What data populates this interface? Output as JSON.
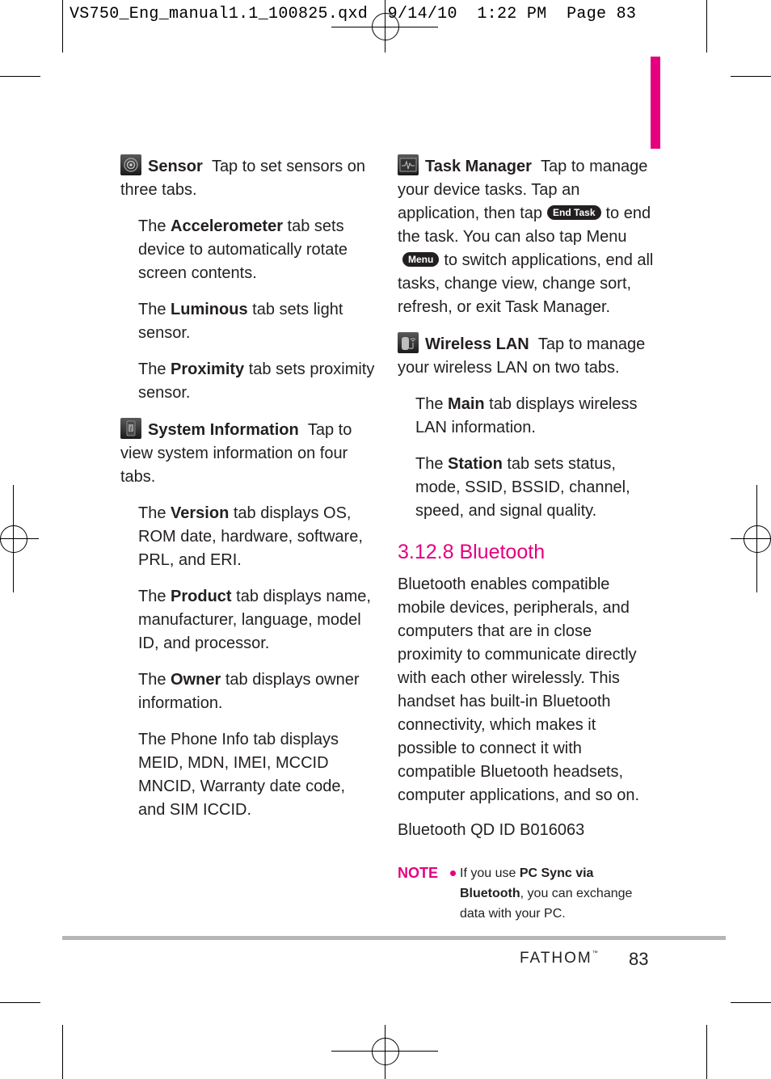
{
  "slug": "VS750_Eng_manual1.1_100825.qxd  9/14/10  1:22 PM  Page 83",
  "colors": {
    "accent": "#e5007e",
    "text": "#231f20",
    "rule": "#b5b5b5"
  },
  "left_column": {
    "sensor": {
      "icon": "sensor-icon",
      "term": "Sensor",
      "desc": "Tap to set sensors on three tabs.",
      "tabs": [
        {
          "pre": "The ",
          "term": "Accelerometer",
          "post": " tab sets device to automatically rotate screen contents."
        },
        {
          "pre": "The ",
          "term": "Luminous",
          "post": " tab sets light sensor."
        },
        {
          "pre": "The ",
          "term": "Proximity",
          "post": " tab sets proximity sensor."
        }
      ]
    },
    "system_info": {
      "icon": "info-icon",
      "term": "System Information",
      "desc": "Tap to view system information on four tabs.",
      "tabs": [
        {
          "pre": "The ",
          "term": "Version",
          "post": " tab displays OS, ROM date, hardware, software, PRL, and ERI."
        },
        {
          "pre": "The ",
          "term": "Product",
          "post": " tab displays name, manufacturer, language, model ID, and processor."
        },
        {
          "pre": "The ",
          "term": "Owner",
          "post": " tab displays owner information."
        },
        {
          "pre": "The Phone Info tab displays MEID, MDN, IMEI, MCCID MNCID, Warranty date code, and SIM ICCID.",
          "term": "",
          "post": ""
        }
      ]
    }
  },
  "right_column": {
    "task_manager": {
      "icon": "task-manager-icon",
      "term": "Task Manager",
      "desc_1": "Tap to manage your device tasks. Tap an application, then tap",
      "end_task_button": "End Task",
      "desc_2": "to end the task. You can also tap Menu",
      "menu_button": "Menu",
      "desc_3": "to switch applications, end all tasks, change view, change sort, refresh, or exit Task Manager."
    },
    "wireless_lan": {
      "icon": "wireless-lan-icon",
      "term": "Wireless LAN",
      "desc": "Tap to manage your wireless LAN on two tabs.",
      "tabs": [
        {
          "pre": "The ",
          "term": "Main",
          "post": " tab displays wireless LAN information."
        },
        {
          "pre": "The ",
          "term": "Station",
          "post": " tab sets status, mode, SSID, BSSID, channel, speed, and signal quality."
        }
      ]
    },
    "bluetooth": {
      "heading": "3.12.8 Bluetooth",
      "body": "Bluetooth enables compatible mobile devices, peripherals, and computers that are in close proximity to communicate directly with each other wirelessly. This handset has built-in Bluetooth connectivity, which makes it possible to connect it with compatible Bluetooth headsets, computer applications, and so on.",
      "qd_id": "Bluetooth QD ID B016063",
      "note_label": "NOTE",
      "note_pre": "If you use ",
      "note_term": "PC Sync via Bluetooth",
      "note_post": ", you can exchange data with your PC."
    }
  },
  "footer": {
    "brand": "FATHOM",
    "trademark": "™",
    "page_number": "83"
  }
}
